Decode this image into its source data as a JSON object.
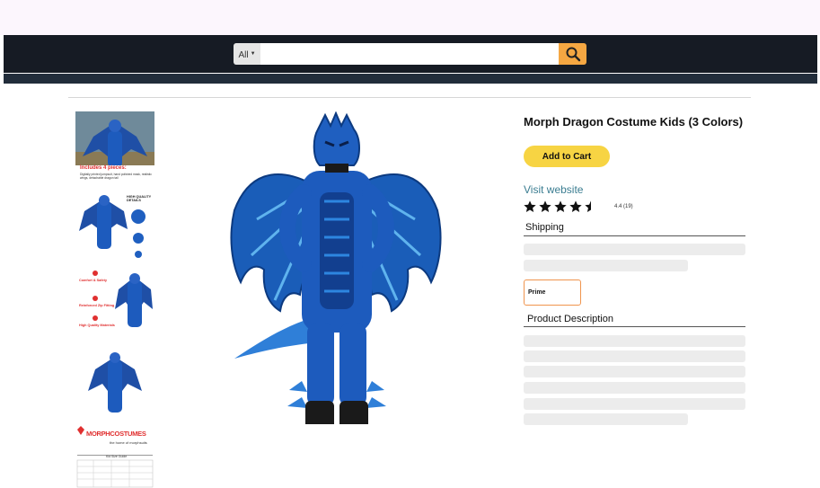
{
  "search": {
    "category": "All",
    "placeholder": "",
    "value": ""
  },
  "gallery": {
    "thumbnails": [
      {
        "name": "thumb-main-outdoor",
        "caption": "Includes 4 pieces:",
        "subcaption": "Digitally printed jumpsuit, hand polished mask, realistic wings, detachable dragon tail"
      },
      {
        "name": "thumb-quality-details",
        "caption": "HIGH QUALITY DETAILS"
      },
      {
        "name": "thumb-features",
        "caption_1": "Comfort & Safety",
        "caption_2": "Reinforced Zip Fitting",
        "caption_3": "High Quality Materials"
      },
      {
        "name": "thumb-back-view",
        "caption": ""
      },
      {
        "name": "thumb-size-chart",
        "brand": "MORPHCOSTUMES",
        "tagline": "the home of morphsuits",
        "chart_title": "Kid Size Guide"
      }
    ]
  },
  "product": {
    "title": "Morph Dragon Costume Kids (3 Colors)",
    "add_to_cart": "Add to Cart",
    "visit_website": "Visit website",
    "rating_value": 4.4,
    "rating_text": "4.4 (19)",
    "shipping_heading": "Shipping",
    "prime_label": "Prime",
    "description_heading": "Product Description"
  },
  "colors": {
    "navbar": "#161b24",
    "search_button": "#f5a742",
    "add_to_cart": "#f7d443",
    "link": "#3b7d91",
    "prime_border": "#f0944d",
    "costume_blue": "#1f5fc0"
  },
  "icons": {
    "search": "magnifier-icon",
    "caret": "caret-down-icon",
    "star": "star-icon"
  }
}
